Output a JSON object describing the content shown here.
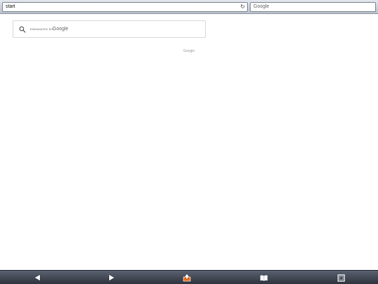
{
  "topbar": {
    "url_value": "start",
    "search_placeholder": "Google"
  },
  "cse": {
    "enhanced_label": "ENHANCED BY",
    "brand_label": "Google"
  },
  "footer": {
    "label": "Google"
  },
  "toolbar": {
    "buttons": [
      "back",
      "forward",
      "share",
      "bookmarks",
      "tabs"
    ]
  },
  "colors": {
    "toolbar_dark": "#2e333d",
    "share_accent": "#e0702a"
  }
}
